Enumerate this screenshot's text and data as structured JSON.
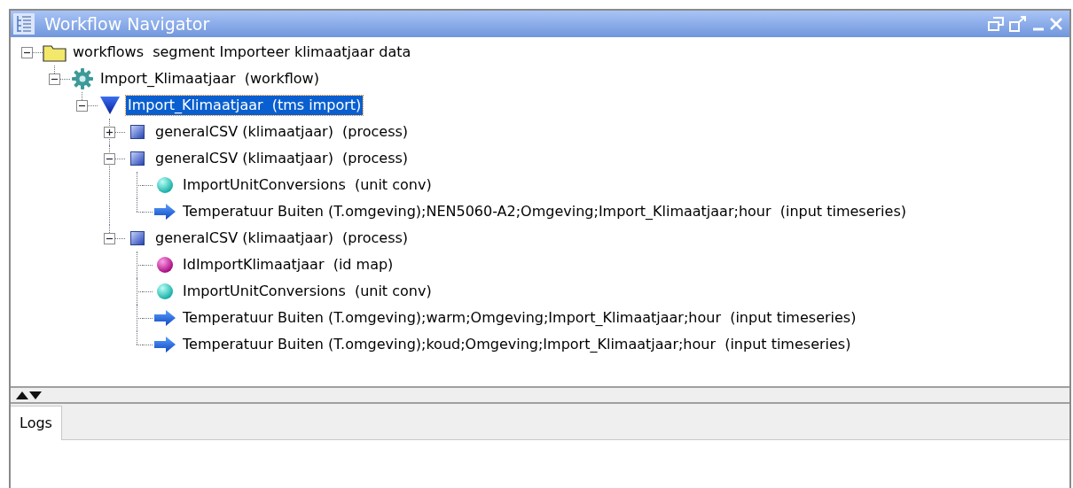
{
  "window": {
    "title": "Workflow Navigator"
  },
  "tree": [
    {
      "label": "workflows  segment Importeer klimaatjaar data",
      "kind": "folder",
      "expanded": true,
      "selected": false,
      "children": [
        {
          "label": "Import_Klimaatjaar  (workflow)",
          "kind": "workflow",
          "expanded": true,
          "selected": false,
          "children": [
            {
              "label": "Import_Klimaatjaar  (tms import)",
              "kind": "tms_import",
              "expanded": true,
              "selected": true,
              "children": [
                {
                  "label": "generalCSV (klimaatjaar)  (process)",
                  "kind": "process",
                  "expanded": false,
                  "selected": false
                },
                {
                  "label": "generalCSV (klimaatjaar)  (process)",
                  "kind": "process",
                  "expanded": true,
                  "selected": false,
                  "children": [
                    {
                      "label": "ImportUnitConversions  (unit conv)",
                      "kind": "unit_conv",
                      "selected": false
                    },
                    {
                      "label": "Temperatuur Buiten (T.omgeving);NEN5060-A2;Omgeving;Import_Klimaatjaar;hour  (input timeseries)",
                      "kind": "timeseries",
                      "selected": false
                    }
                  ]
                },
                {
                  "label": "generalCSV (klimaatjaar)  (process)",
                  "kind": "process",
                  "expanded": true,
                  "selected": false,
                  "children": [
                    {
                      "label": "IdImportKlimaatjaar  (id map)",
                      "kind": "id_map",
                      "selected": false
                    },
                    {
                      "label": "ImportUnitConversions  (unit conv)",
                      "kind": "unit_conv",
                      "selected": false
                    },
                    {
                      "label": "Temperatuur Buiten (T.omgeving);warm;Omgeving;Import_Klimaatjaar;hour  (input timeseries)",
                      "kind": "timeseries",
                      "selected": false
                    },
                    {
                      "label": "Temperatuur Buiten (T.omgeving);koud;Omgeving;Import_Klimaatjaar;hour  (input timeseries)",
                      "kind": "timeseries",
                      "selected": false
                    }
                  ]
                }
              ]
            }
          ]
        }
      ]
    }
  ],
  "bottom_panel": {
    "tabs": [
      {
        "label": "Logs",
        "selected": true
      }
    ]
  }
}
